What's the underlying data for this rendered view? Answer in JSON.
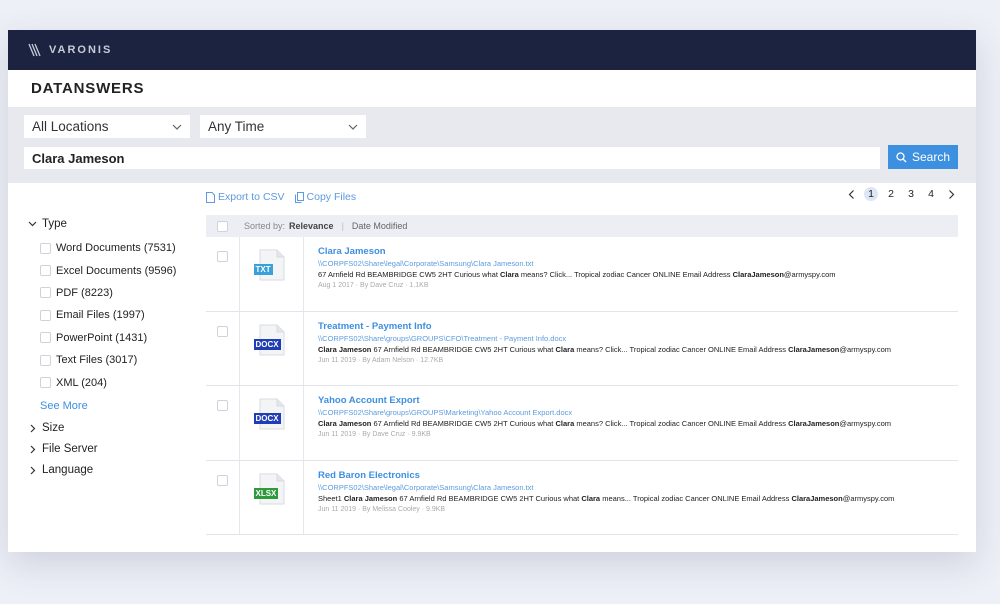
{
  "brand": {
    "logo_text": "VARONIS"
  },
  "app": {
    "title": "DATANSWERS"
  },
  "search": {
    "location": "All Locations",
    "time": "Any Time",
    "query": "Clara Jameson",
    "button_label": "Search"
  },
  "facets": {
    "type_label": "Type",
    "items": [
      {
        "label": "Word Documents (7531)"
      },
      {
        "label": "Excel Documents (9596)"
      },
      {
        "label": "PDF (8223)"
      },
      {
        "label": "Email Files (1997)"
      },
      {
        "label": "PowerPoint (1431)"
      },
      {
        "label": "Text Files (3017)"
      },
      {
        "label": "XML (204)"
      }
    ],
    "see_more": "See More",
    "size_label": "Size",
    "file_server_label": "File Server",
    "language_label": "Language"
  },
  "actions": {
    "export": "Export to CSV",
    "copy": "Copy Files"
  },
  "pagination": {
    "pages": [
      "1",
      "2",
      "3",
      "4"
    ],
    "current": "1"
  },
  "sort": {
    "prefix": "Sorted by:",
    "active": "Relevance",
    "other": "Date Modified"
  },
  "colors": {
    "topbar": "#1c2340",
    "accent": "#3d8fe0",
    "txt_badge": "#3aa0d8",
    "docx_badge": "#1f3db5",
    "xlsx_badge": "#2e9a3c"
  },
  "results": [
    {
      "title": "Clara Jameson",
      "path": "\\\\CORPFS02\\Share\\legal\\Corporate\\Samsung\\Clara Jameson.txt",
      "snippet_pre": "",
      "snippet_name": "",
      "snippet_mid": "67 Arnfield Rd BEAMBRIDGE CW5 2HT Curious what ",
      "snippet_clara": "Clara",
      "snippet_post": " means? Click... Tropical zodiac Cancer ONLINE Email Address ",
      "snippet_email_bold": "ClaraJameson",
      "snippet_email_rest": "@armyspy.com",
      "meta": "Aug 1 2017  ·  By Dave Cruz  ·  1.1KB",
      "badge": "TXT",
      "icon": "txt-file-icon"
    },
    {
      "title": "Treatment - Payment Info",
      "path": "\\\\CORPFS02\\Share\\groups\\GROUPS\\CFO\\Treatment - Payment Info.docx",
      "snippet_pre": "",
      "snippet_name": "Clara Jameson",
      "snippet_mid": " 67 Arnfield Rd BEAMBRIDGE CW5 2HT Curious what ",
      "snippet_clara": "Clara",
      "snippet_post": " means? Click... Tropical zodiac Cancer ONLINE Email Address ",
      "snippet_email_bold": "ClaraJameson",
      "snippet_email_rest": "@armyspy.com",
      "meta": "Jun 11 2019  ·  By Adam Nelson  ·  12.7KB",
      "badge": "DOCX",
      "icon": "docx-file-icon"
    },
    {
      "title": "Yahoo Account Export",
      "path": "\\\\CORPFS02\\Share\\groups\\GROUPS\\Marketing\\Yahoo Account Export.docx",
      "snippet_pre": "",
      "snippet_name": "Clara Jameson",
      "snippet_mid": " 67 Arnfield Rd BEAMBRIDGE CW5 2HT Curious what ",
      "snippet_clara": "Clara",
      "snippet_post": " means? Click... Tropical zodiac Cancer ONLINE Email Address ",
      "snippet_email_bold": "ClaraJameson",
      "snippet_email_rest": "@armyspy.com",
      "meta": "Jun 11 2019  ·  By Dave Cruz  ·  9.9KB",
      "badge": "DOCX",
      "icon": "docx-file-icon"
    },
    {
      "title": "Red Baron Electronics",
      "path": "\\\\CORPFS02\\Share\\legal\\Corporate\\Samsung\\Clara Jameson.txt",
      "snippet_pre": "Sheet1 ",
      "snippet_name": "Clara Jameson",
      "snippet_mid": " 67 Arnfield Rd BEAMBRIDGE CW5 2HT Curious what ",
      "snippet_clara": "Clara",
      "snippet_post": " means... Tropical zodiac Cancer ONLINE Email Address ",
      "snippet_email_bold": "ClaraJameson",
      "snippet_email_rest": "@armyspy.com",
      "meta": "Jun 11 2019  ·  By Melissa Cooley  ·  9.9KB",
      "badge": "XLSX",
      "icon": "xlsx-file-icon"
    }
  ]
}
